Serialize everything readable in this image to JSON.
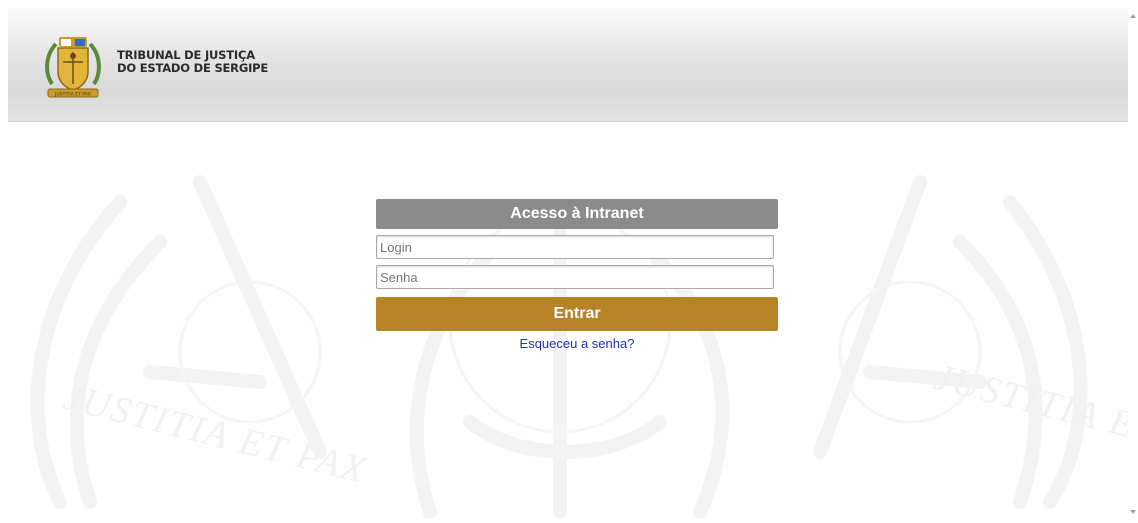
{
  "header": {
    "org_name_line1": "TRIBUNAL DE JUSTIÇA",
    "org_name_line2": "DO ESTADO DE SERGIPE",
    "logo_banner_text": "JUSTITIA ET PAX"
  },
  "background": {
    "watermark_text": "JUSTITIA ET PAX",
    "icon": "tjse-coat-of-arms-watermark"
  },
  "login": {
    "title": "Acesso à Intranet",
    "login_placeholder": "Login",
    "login_value": "",
    "password_placeholder": "Senha",
    "password_value": "",
    "submit_label": "Entrar",
    "forgot_label": "Esqueceu a senha?"
  },
  "colors": {
    "title_bar": "#8b8b8b",
    "submit_button": "#b88327",
    "link": "#1f32a8"
  }
}
